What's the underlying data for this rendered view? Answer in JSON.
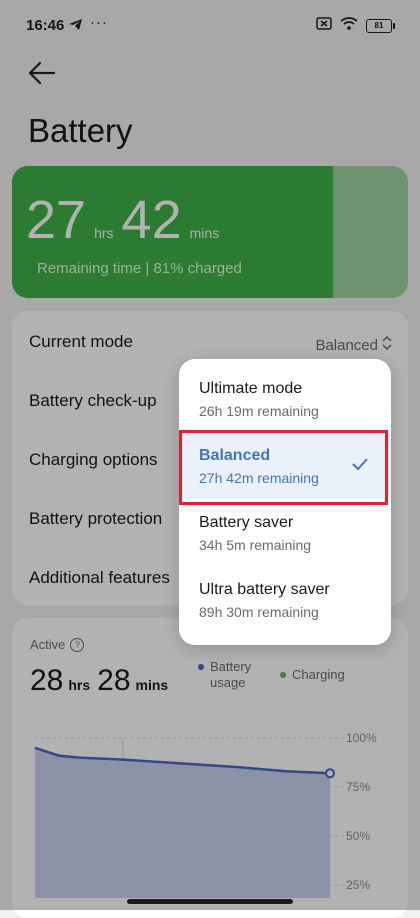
{
  "status_bar": {
    "time": "16:46",
    "more": "···",
    "battery_level": "81"
  },
  "page": {
    "title": "Battery"
  },
  "summary": {
    "hours": "27",
    "hours_unit": "hrs",
    "minutes": "42",
    "minutes_unit": "mins",
    "subtitle": "Remaining time | 81% charged",
    "charge_percent": 81
  },
  "settings": {
    "current_mode_label": "Current mode",
    "current_mode_value": "Balanced",
    "checkup": "Battery check-up",
    "charging": "Charging options",
    "protection": "Battery protection",
    "additional": "Additional features"
  },
  "active": {
    "label": "Active",
    "hours": "28",
    "hours_unit": "hrs",
    "minutes": "28",
    "minutes_unit": "mins",
    "legend_usage_line1": "Battery",
    "legend_usage_line2": "usage",
    "legend_charging": "Charging"
  },
  "chart_data": {
    "type": "area",
    "y_ticks": [
      "100%",
      "75%",
      "50%",
      "25%"
    ],
    "ylim": [
      0,
      100
    ],
    "series": [
      {
        "name": "Battery usage",
        "color": "#4a66c8",
        "x": [
          0,
          0.08,
          0.15,
          0.3,
          0.5,
          0.7,
          0.85,
          1.0
        ],
        "values": [
          95,
          91,
          90,
          89,
          87,
          85,
          83,
          82
        ]
      }
    ],
    "grid": true
  },
  "mode_menu": {
    "options": [
      {
        "label": "Ultimate mode",
        "sub": "26h 19m remaining"
      },
      {
        "label": "Balanced",
        "sub": "27h 42m remaining"
      },
      {
        "label": "Battery saver",
        "sub": "34h 5m remaining"
      },
      {
        "label": "Ultra battery saver",
        "sub": "89h 30m remaining"
      }
    ],
    "selected_index": 1
  },
  "colors": {
    "accent_green": "#3fb049",
    "accent_blue": "#4473c4",
    "highlight_red": "#d7262e",
    "usage_dot": "#4a66c8",
    "charging_dot": "#5bb86a"
  }
}
